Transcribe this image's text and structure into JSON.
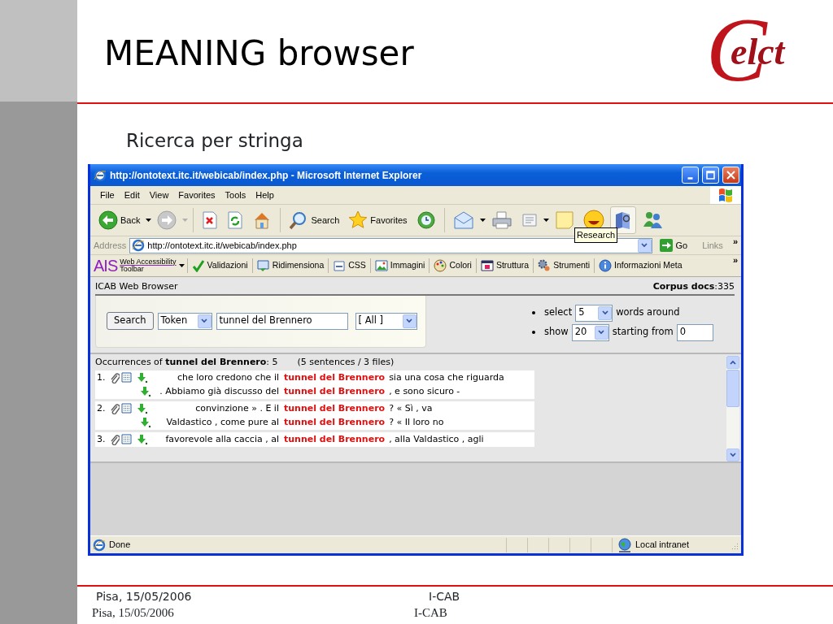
{
  "slide": {
    "title": "MEANING browser",
    "logo": {
      "initial": "C",
      "text": "elct"
    },
    "subtitle": "Ricerca per stringa"
  },
  "browser": {
    "title": "http://ontotext.itc.it/webicab/index.php - Microsoft Internet Explorer",
    "menu": [
      "File",
      "Edit",
      "View",
      "Favorites",
      "Tools",
      "Help"
    ],
    "toolbar": [
      {
        "kind": "back",
        "label": "Back",
        "dropdown": true,
        "hovered": false
      },
      {
        "kind": "forward",
        "dropdown": true,
        "hovered": false
      },
      {
        "kind": "separator"
      },
      {
        "kind": "stop",
        "hovered": false
      },
      {
        "kind": "refresh",
        "hovered": false
      },
      {
        "kind": "home",
        "hovered": false
      },
      {
        "kind": "separator"
      },
      {
        "kind": "search",
        "label": "Search",
        "hovered": false
      },
      {
        "kind": "favorites",
        "label": "Favorites",
        "hovered": false
      },
      {
        "kind": "history",
        "hovered": false
      },
      {
        "kind": "separator"
      },
      {
        "kind": "mail",
        "dropdown": true,
        "hovered": false
      },
      {
        "kind": "print",
        "hovered": false
      },
      {
        "kind": "word",
        "dropdown": true,
        "hovered": false
      },
      {
        "kind": "note",
        "hovered": false
      },
      {
        "kind": "smiley",
        "hovered": false
      },
      {
        "kind": "research",
        "hovered": true,
        "tooltip": "Research"
      },
      {
        "kind": "messenger",
        "hovered": false
      }
    ],
    "address": {
      "label": "Address",
      "url": "http://ontotext.itc.it/webicab/index.php",
      "go": "Go",
      "links": "Links",
      "more": "»"
    },
    "ais": {
      "logo": "AIS",
      "name_top": "Web Accessibility",
      "name_bottom": "Toolbar",
      "more": "»",
      "items": [
        {
          "kind": "check",
          "label": "Validazioni"
        },
        {
          "kind": "resize",
          "label": "Ridimensiona"
        },
        {
          "kind": "css",
          "label": "CSS"
        },
        {
          "kind": "images",
          "label": "Immagini"
        },
        {
          "kind": "palette",
          "label": "Colori"
        },
        {
          "kind": "structure",
          "label": "Struttura"
        },
        {
          "kind": "gear",
          "label": "Strumenti"
        },
        {
          "kind": "info",
          "label": "Informazioni Meta"
        }
      ]
    },
    "page": {
      "header": "ICAB Web Browser",
      "corpus": "**Corpus docs**:335",
      "search": {
        "button": "Search",
        "type": "Token",
        "query": "tunnel del Brennero",
        "scope": "[ All ]"
      },
      "options": [
        {
          "label": "select",
          "value": "5",
          "suffix": "words around"
        },
        {
          "label": "show",
          "value": "20",
          "suffix": "starting from",
          "input": "0"
        }
      ],
      "summary": "Occurrences of **tunnel del Brennero**: 5",
      "summary_note": "(5 sentences / 3 files)",
      "results": [
        {
          "number": "1.",
          "lines": [
            {
              "before": "che loro credono che il",
              "hit": "tunnel del Brennero",
              "after": "sia una cosa che riguarda"
            },
            {
              "before": ". Abbiamo già discusso del",
              "hit": "tunnel del Brennero",
              "after": ", e sono sicuro -"
            }
          ]
        },
        {
          "number": "2.",
          "lines": [
            {
              "before": "convinzione » . E il",
              "hit": "tunnel del Brennero",
              "after": "? « Sì , va"
            },
            {
              "before": "Valdastico , come pure al",
              "hit": "tunnel del Brennero",
              "after": "? « Il loro no"
            }
          ]
        },
        {
          "number": "3.",
          "lines": [
            {
              "before": "favorevole alla caccia , al",
              "hit": "tunnel del Brennero",
              "after": ", alla Valdastico , agli"
            }
          ]
        }
      ]
    },
    "status": {
      "text": "Done",
      "zone": "Local intranet"
    }
  },
  "footer": {
    "date": [
      "Pisa, 15/05/2006",
      "Pisa, 15/05/2006"
    ],
    "event": [
      "I-CAB",
      "I-CAB"
    ]
  }
}
